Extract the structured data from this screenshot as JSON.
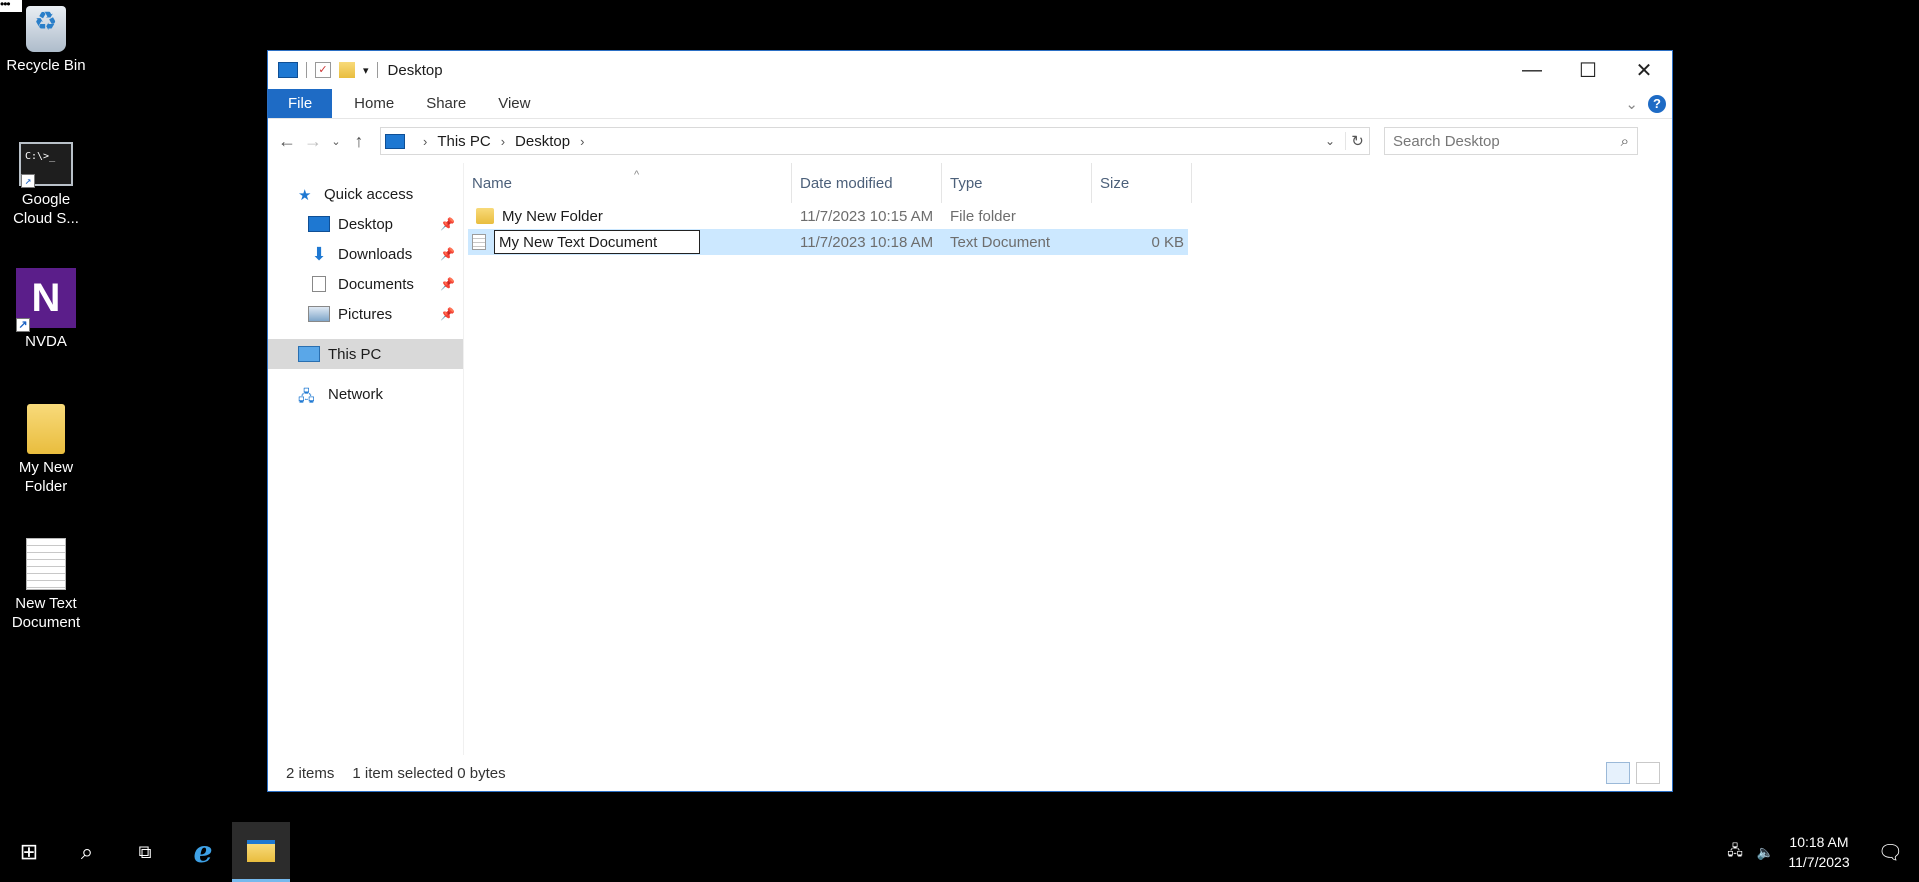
{
  "desktop": {
    "menu_dots": "•••",
    "icons": [
      {
        "label": "Recycle Bin"
      },
      {
        "label": "Google Cloud S...",
        "glyph_text": "C:\\>_"
      },
      {
        "label": "NVDA",
        "glyph_text": "N"
      },
      {
        "label": "My New Folder"
      },
      {
        "label": "New Text Document"
      }
    ]
  },
  "window": {
    "title": "Desktop",
    "controls": {
      "minimize": "—",
      "maximize": "☐",
      "close": "✕"
    }
  },
  "ribbon": {
    "tabs": [
      "File",
      "Home",
      "Share",
      "View"
    ]
  },
  "address": {
    "crumbs": [
      "This PC",
      "Desktop"
    ],
    "search_placeholder": "Search Desktop"
  },
  "nav_pane": {
    "quick_access": "Quick access",
    "pinned": [
      "Desktop",
      "Downloads",
      "Documents",
      "Pictures"
    ],
    "this_pc": "This PC",
    "network": "Network"
  },
  "columns": [
    "Name",
    "Date modified",
    "Type",
    "Size"
  ],
  "files": [
    {
      "name": "My New Folder",
      "date": "11/7/2023 10:15 AM",
      "type": "File folder",
      "size": ""
    },
    {
      "name": "My New Text Document",
      "date": "11/7/2023 10:18 AM",
      "type": "Text Document",
      "size": "0 KB",
      "renaming": true
    }
  ],
  "status": {
    "items": "2 items",
    "selected": "1 item selected",
    "bytes": "0 bytes"
  },
  "taskbar": {
    "time": "10:18 AM",
    "date": "11/7/2023"
  },
  "colors": {
    "accent": "#1e6bc5",
    "selection": "#cce8ff"
  }
}
